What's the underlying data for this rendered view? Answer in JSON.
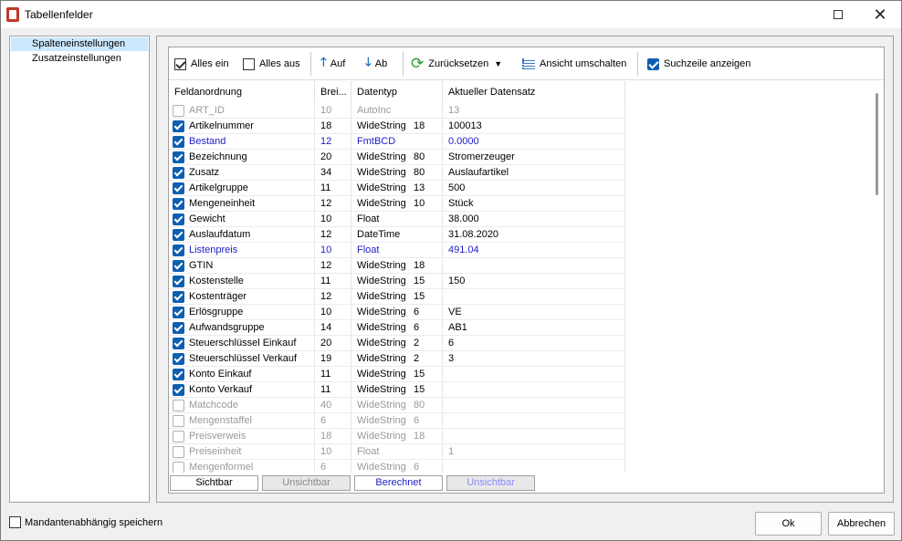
{
  "window": {
    "title": "Tabellenfelder"
  },
  "nav": {
    "items": [
      "Spalteneinstellungen",
      "Zusatzeinstellungen"
    ]
  },
  "toolbar": {
    "alles_ein": "Alles ein",
    "alles_aus": "Alles aus",
    "auf": "Auf",
    "ab": "Ab",
    "zuruecksetzen": "Zurücksetzen",
    "ansicht": "Ansicht umschalten",
    "suchzeile": "Suchzeile anzeigen"
  },
  "table": {
    "headers": [
      "Feldanordnung",
      "Brei...",
      "Datentyp",
      "Aktueller Datensatz"
    ],
    "rows": [
      {
        "name": "ART_ID",
        "width": "10",
        "type": "AutoInc",
        "len": "",
        "value": "13",
        "checked": false,
        "style": "hid"
      },
      {
        "name": "Artikelnummer",
        "width": "18",
        "type": "WideString",
        "len": "18",
        "value": "100013",
        "checked": true,
        "style": "vis"
      },
      {
        "name": "Bestand",
        "width": "12",
        "type": "FmtBCD",
        "len": "",
        "value": "0.0000",
        "checked": true,
        "style": "calc"
      },
      {
        "name": "Bezeichnung",
        "width": "20",
        "type": "WideString",
        "len": "80",
        "value": "Stromerzeuger",
        "checked": true,
        "style": "vis"
      },
      {
        "name": "Zusatz",
        "width": "34",
        "type": "WideString",
        "len": "80",
        "value": "Auslaufartikel",
        "checked": true,
        "style": "vis"
      },
      {
        "name": "Artikelgruppe",
        "width": "11",
        "type": "WideString",
        "len": "13",
        "value": "500",
        "checked": true,
        "style": "vis"
      },
      {
        "name": "Mengeneinheit",
        "width": "12",
        "type": "WideString",
        "len": "10",
        "value": "Stück",
        "checked": true,
        "style": "vis"
      },
      {
        "name": "Gewicht",
        "width": "10",
        "type": "Float",
        "len": "",
        "value": "38.000",
        "checked": true,
        "style": "vis"
      },
      {
        "name": "Auslaufdatum",
        "width": "12",
        "type": "DateTime",
        "len": "",
        "value": "31.08.2020",
        "checked": true,
        "style": "vis"
      },
      {
        "name": "Listenpreis",
        "width": "10",
        "type": "Float",
        "len": "",
        "value": "491.04",
        "checked": true,
        "style": "calc"
      },
      {
        "name": "GTIN",
        "width": "12",
        "type": "WideString",
        "len": "18",
        "value": "",
        "checked": true,
        "style": "vis"
      },
      {
        "name": "Kostenstelle",
        "width": "11",
        "type": "WideString",
        "len": "15",
        "value": "150",
        "checked": true,
        "style": "vis"
      },
      {
        "name": "Kostenträger",
        "width": "12",
        "type": "WideString",
        "len": "15",
        "value": "",
        "checked": true,
        "style": "vis"
      },
      {
        "name": "Erlösgruppe",
        "width": "10",
        "type": "WideString",
        "len": "6",
        "value": "VE",
        "checked": true,
        "style": "vis"
      },
      {
        "name": "Aufwandsgruppe",
        "width": "14",
        "type": "WideString",
        "len": "6",
        "value": "AB1",
        "checked": true,
        "style": "vis"
      },
      {
        "name": "Steuerschlüssel Einkauf",
        "width": "20",
        "type": "WideString",
        "len": "2",
        "value": "6",
        "checked": true,
        "style": "vis"
      },
      {
        "name": "Steuerschlüssel Verkauf",
        "width": "19",
        "type": "WideString",
        "len": "2",
        "value": "3",
        "checked": true,
        "style": "vis"
      },
      {
        "name": "Konto Einkauf",
        "width": "11",
        "type": "WideString",
        "len": "15",
        "value": "",
        "checked": true,
        "style": "vis"
      },
      {
        "name": "Konto Verkauf",
        "width": "11",
        "type": "WideString",
        "len": "15",
        "value": "",
        "checked": true,
        "style": "vis"
      },
      {
        "name": "Matchcode",
        "width": "40",
        "type": "WideString",
        "len": "80",
        "value": "",
        "checked": false,
        "style": "hid"
      },
      {
        "name": "Mengenstaffel",
        "width": "6",
        "type": "WideString",
        "len": "6",
        "value": "",
        "checked": false,
        "style": "hid"
      },
      {
        "name": "Preisverweis",
        "width": "18",
        "type": "WideString",
        "len": "18",
        "value": "",
        "checked": false,
        "style": "hid"
      },
      {
        "name": "Preiseinheit",
        "width": "10",
        "type": "Float",
        "len": "",
        "value": "1",
        "checked": false,
        "style": "hid"
      },
      {
        "name": "Mengenformel",
        "width": "6",
        "type": "WideString",
        "len": "6",
        "value": "",
        "checked": false,
        "style": "hid"
      }
    ]
  },
  "legend": {
    "sichtbar": "Sichtbar",
    "unsichtbar": "Unsichtbar",
    "berechnet": "Berechnet",
    "unsichtbar2": "Unsichtbar"
  },
  "footer": {
    "mandant": "Mandantenabhängig speichern",
    "ok": "Ok",
    "abbrechen": "Abbrechen"
  },
  "colors": {
    "calc": "#1c1cc8",
    "hidden": "#999999",
    "check": "#0f5fb0"
  }
}
